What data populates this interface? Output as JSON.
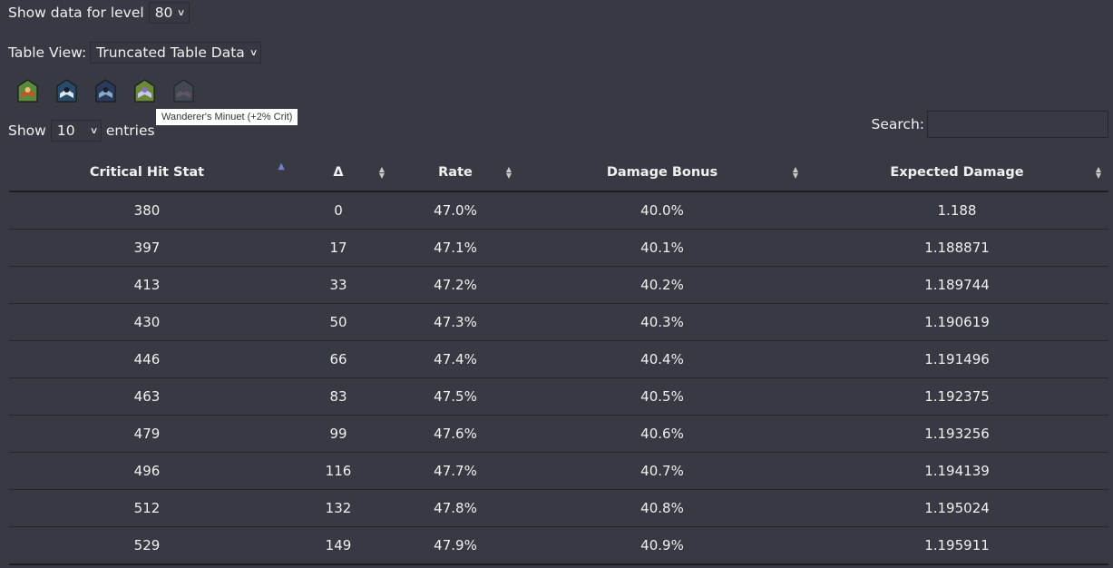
{
  "level": {
    "label": "Show data for level",
    "value": "80"
  },
  "table_view": {
    "label": "Table View:",
    "value": "Truncated Table Data"
  },
  "buffs": [
    {
      "name": "buff-1",
      "colors": [
        "#5a8a3a",
        "#c8502a",
        "#e8c070"
      ]
    },
    {
      "name": "buff-2",
      "colors": [
        "#2a4a6a",
        "#d8e8f0",
        "#1a1a2a"
      ]
    },
    {
      "name": "buff-3",
      "colors": [
        "#2a3a5a",
        "#8aa8c8",
        "#1a2030"
      ]
    },
    {
      "name": "buff-4",
      "colors": [
        "#6a8a3a",
        "#c8c8f0",
        "#8a6ac8"
      ]
    },
    {
      "name": "wanderers-minuet",
      "colors": [
        "#4a5060",
        "#7a6a7a",
        "#5a4a5a"
      ]
    }
  ],
  "tooltip": "Wanderer's Minuet (+2% Crit)",
  "entries": {
    "show_label": "Show",
    "value": "10",
    "suffix": "entries"
  },
  "search": {
    "label": "Search:",
    "value": "",
    "placeholder": ""
  },
  "table": {
    "columns": [
      "Critical Hit Stat",
      "Δ",
      "Rate",
      "Damage Bonus",
      "Expected Damage"
    ],
    "sort": {
      "column": 0,
      "direction": "asc"
    },
    "rows": [
      [
        "380",
        "0",
        "47.0%",
        "40.0%",
        "1.188"
      ],
      [
        "397",
        "17",
        "47.1%",
        "40.1%",
        "1.188871"
      ],
      [
        "413",
        "33",
        "47.2%",
        "40.2%",
        "1.189744"
      ],
      [
        "430",
        "50",
        "47.3%",
        "40.3%",
        "1.190619"
      ],
      [
        "446",
        "66",
        "47.4%",
        "40.4%",
        "1.191496"
      ],
      [
        "463",
        "83",
        "47.5%",
        "40.5%",
        "1.192375"
      ],
      [
        "479",
        "99",
        "47.6%",
        "40.6%",
        "1.193256"
      ],
      [
        "496",
        "116",
        "47.7%",
        "40.7%",
        "1.194139"
      ],
      [
        "512",
        "132",
        "47.8%",
        "40.8%",
        "1.195024"
      ],
      [
        "529",
        "149",
        "47.9%",
        "40.9%",
        "1.195911"
      ]
    ]
  }
}
